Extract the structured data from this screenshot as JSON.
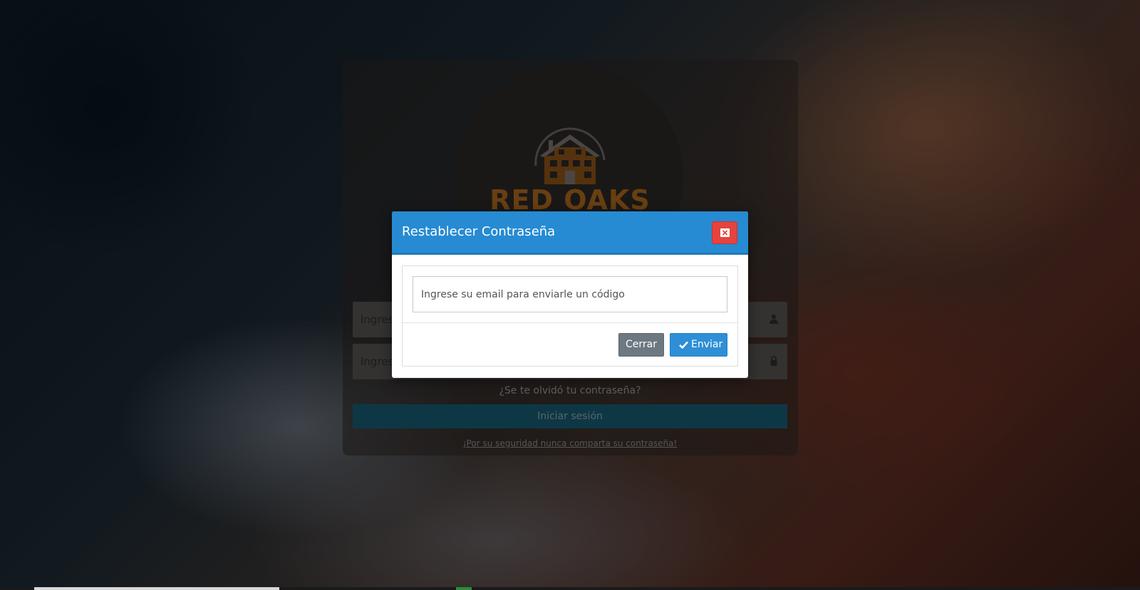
{
  "brand": {
    "logo_text": "RED OAKS",
    "logo_color": "#a9661d"
  },
  "login": {
    "user_placeholder": "Ingrese",
    "user_icon": "user-icon",
    "pass_placeholder": "Ingrese",
    "pass_icon": "lock-icon",
    "forgot_link": "¿Se te olvidó tu contraseña?",
    "submit_label": "Iniciar sesión",
    "security_note": "¡Por su seguridad nunca comparta su contraseña!"
  },
  "modal": {
    "title": "Restablecer Contraseña",
    "close_icon": "close-icon",
    "email_placeholder": "Ingrese su email para enviarle un código",
    "cancel_label": "Cerrar",
    "submit_label": "Enviar",
    "submit_icon": "check-icon",
    "header_color": "#268bd2",
    "close_color": "#e5433e"
  }
}
